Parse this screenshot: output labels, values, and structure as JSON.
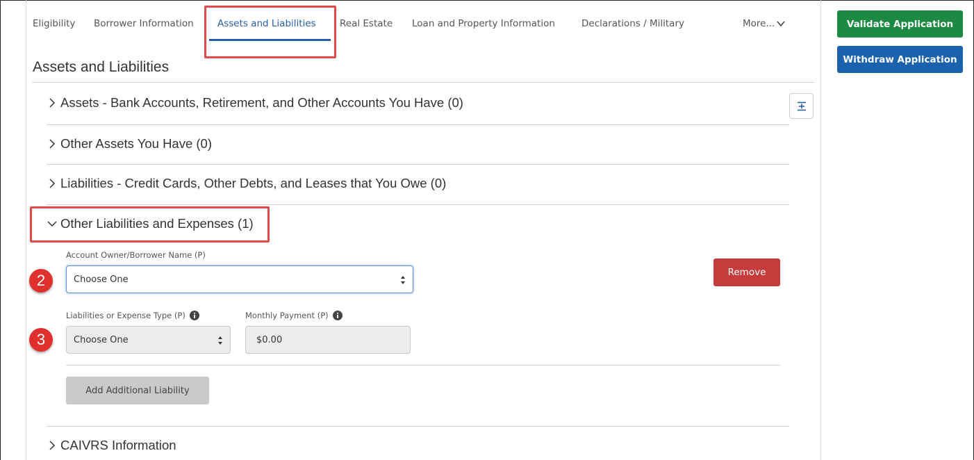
{
  "tabs": [
    {
      "label": "Eligibility",
      "active": false
    },
    {
      "label": "Borrower Information",
      "active": false
    },
    {
      "label": "Assets and Liabilities",
      "active": true
    },
    {
      "label": "Real Estate",
      "active": false
    },
    {
      "label": "Loan and Property Information",
      "active": false
    },
    {
      "label": "Declarations / Military",
      "active": false
    },
    {
      "label": "More...",
      "active": false
    }
  ],
  "actions": {
    "validate_label": "Validate Application",
    "withdraw_label": "Withdraw Application"
  },
  "page": {
    "title": "Assets and Liabilities"
  },
  "sections": [
    {
      "label": "Assets - Bank Accounts, Retirement, and Other Accounts You Have (0)",
      "expanded": false
    },
    {
      "label": "Other Assets You Have (0)",
      "expanded": false
    },
    {
      "label": "Liabilities - Credit Cards, Other Debts, and Leases that You Owe (0)",
      "expanded": false
    },
    {
      "label": "Other Liabilities and Expenses (1)",
      "expanded": true
    },
    {
      "label": "CAIVRS Information",
      "expanded": false
    }
  ],
  "form": {
    "owner_label": "Account Owner/Borrower Name (P)",
    "owner_value": "Choose One",
    "type_label": "Liabilities or Expense Type (P)",
    "type_value": "Choose One",
    "payment_label": "Monthly Payment (P)",
    "payment_value": "$0.00",
    "remove_label": "Remove",
    "add_label": "Add Additional Liability"
  },
  "markers": {
    "step2": "2",
    "step3": "3"
  },
  "colors": {
    "accent": "#2a5ea8",
    "validate": "#1d8a43",
    "withdraw": "#1b62ad",
    "remove": "#c63b3b",
    "highlight": "#e04a4a",
    "marker": "#e0302d"
  }
}
